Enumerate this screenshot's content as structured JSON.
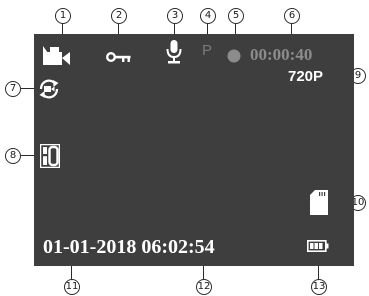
{
  "callouts": [
    "1",
    "2",
    "3",
    "4",
    "5",
    "6",
    "7",
    "8",
    "9",
    "10",
    "11",
    "12",
    "13"
  ],
  "status_bar": {
    "parking_label": "P",
    "record_time": "00:00:40",
    "resolution": "720P"
  },
  "footer": {
    "datetime": "01-01-2018 06:02:54"
  },
  "icons": [
    "video-camera-icon",
    "key-icon",
    "microphone-icon",
    "record-dot-icon",
    "loop-recording-icon",
    "exposure-value-icon",
    "sd-card-icon",
    "battery-icon"
  ],
  "colors": {
    "screen": "#3e3e3e",
    "icon": "#ffffff",
    "dimmed": "#7a7a7a",
    "time_dimmed": "#8c8c8c"
  }
}
